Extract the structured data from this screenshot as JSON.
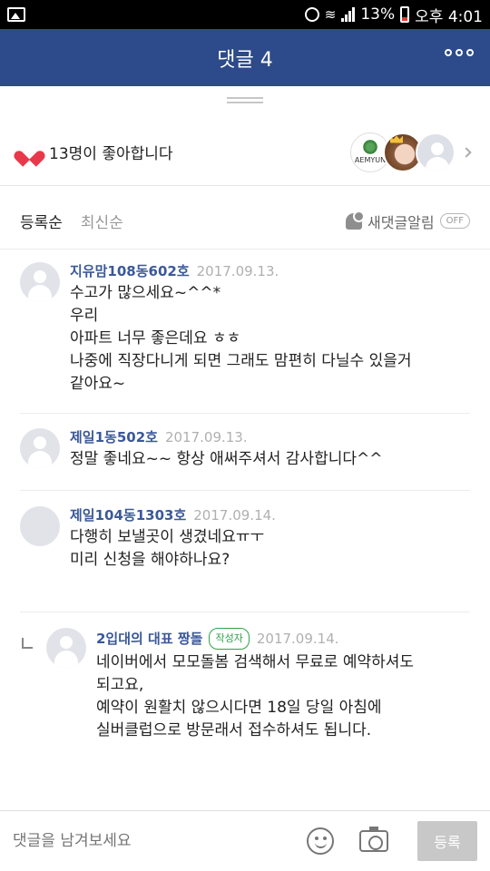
{
  "status_bar": {
    "battery": "13%",
    "time": "오후 4:01"
  },
  "header": {
    "title": "댓글 4"
  },
  "likes": {
    "text": "13명이 좋아합니다",
    "brand_avatar_text": "AEMYUN"
  },
  "sort": {
    "tab_registered": "등록순",
    "tab_latest": "최신순",
    "notify_label": "새댓글알림",
    "toggle": "OFF"
  },
  "comments": [
    {
      "author": "지유맘108동602호",
      "date": "2017.09.13.",
      "lines": [
        "수고가 많으세요~^^*",
        "우리",
        "아파트 너무 좋은데요 ㅎㅎ",
        "나중에 직장다니게 되면 그래도 맘편히 다닐수 있을거",
        "같아요~"
      ]
    },
    {
      "author": "제일1동502호",
      "date": "2017.09.13.",
      "lines": [
        "정말 좋네요~~ 항상 애써주셔서 감사합니다^^"
      ]
    },
    {
      "author": "제일104동1303호",
      "date": "2017.09.14.",
      "lines": [
        "다행히 보낼곳이 생겼네요ㅠㅜ",
        "미리 신청을 해야하나요?"
      ]
    },
    {
      "author": "2입대의 대표 짱돌",
      "badge": "작성자",
      "date": "2017.09.14.",
      "lines": [
        "네이버에서 모모돌봄 검색해서 무료로 예약하셔도",
        "되고요,",
        "예약이 원활치 않으시다면 18일 당일 아침에",
        "실버클럽으로 방문래서 접수하셔도 됩니다."
      ]
    }
  ],
  "input": {
    "placeholder": "댓글을 남겨보세요",
    "submit": "등록"
  }
}
